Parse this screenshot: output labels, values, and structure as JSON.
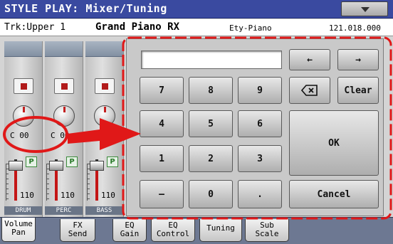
{
  "window": {
    "title": "STYLE PLAY: Mixer/Tuning",
    "menu_icon": "chevron-down-icon"
  },
  "track": {
    "label": "Trk:Upper 1",
    "sound_name": "Grand Piano RX",
    "category": "Ety-Piano",
    "bank_number": "121.018.000"
  },
  "mixer": {
    "channels": [
      {
        "name": "DRUM",
        "pan": "C 00",
        "play": "P",
        "volume": "110"
      },
      {
        "name": "PERC",
        "pan": "C 00",
        "play": "P",
        "volume": "110"
      },
      {
        "name": "BASS",
        "pan": "C 00",
        "play": "P",
        "volume": "110"
      }
    ]
  },
  "keypad": {
    "display_value": "",
    "keys": {
      "k7": "7",
      "k8": "8",
      "k9": "9",
      "k4": "4",
      "k5": "5",
      "k6": "6",
      "k1": "1",
      "k2": "2",
      "k3": "3",
      "minus": "–",
      "k0": "0",
      "dot": ".",
      "clear": "Clear",
      "ok": "OK",
      "cancel": "Cancel",
      "left_arrow": "←",
      "right_arrow": "→",
      "backspace_icon": "backspace-icon"
    }
  },
  "tabs": [
    {
      "label": "Volume\nPan",
      "active": true
    },
    {
      "label": "FX\nSend",
      "active": false
    },
    {
      "label": "EQ\nGain",
      "active": false
    },
    {
      "label": "EQ\nControl",
      "active": false
    },
    {
      "label": "Tuning",
      "active": false
    },
    {
      "label": "Sub\nScale",
      "active": false
    }
  ],
  "annotation": {
    "color": "#e01818"
  }
}
